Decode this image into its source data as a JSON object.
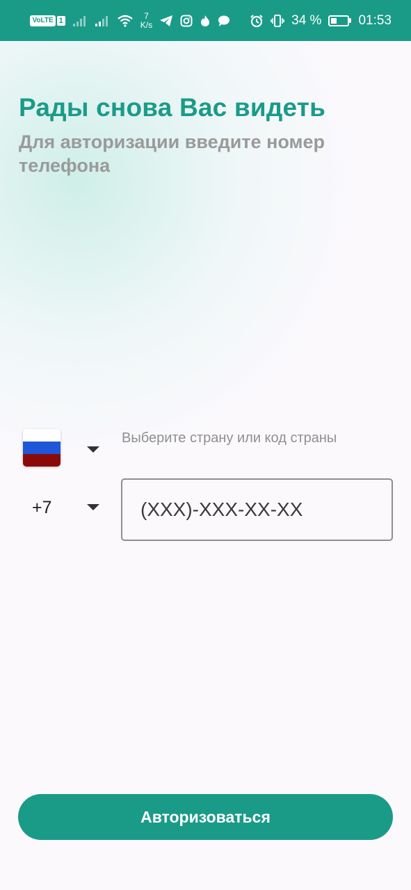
{
  "status_bar": {
    "volte": "VoLTE",
    "sim": "1",
    "speed_value": "7",
    "speed_unit": "K/s",
    "battery": "34 %",
    "time": "01:53",
    "icons": [
      "signal-icon",
      "signal-icon",
      "wifi-icon",
      "telegram-icon",
      "instagram-icon",
      "flame-icon",
      "chat-icon",
      "alarm-icon",
      "vibrate-icon",
      "battery-icon"
    ]
  },
  "header": {
    "title": "Рады снова Вас видеть",
    "subtitle": "Для авторизации введите номер телефона"
  },
  "country": {
    "flag": "russia-flag",
    "hint": "Выберите страну или код страны",
    "code": "+7"
  },
  "phone": {
    "placeholder": "(XXX)-XXX-XX-XX"
  },
  "actions": {
    "login_label": "Авторизоваться"
  },
  "colors": {
    "accent": "#1a9b88",
    "background": "#fcf9fd",
    "hint_text": "#8f8f8f"
  }
}
